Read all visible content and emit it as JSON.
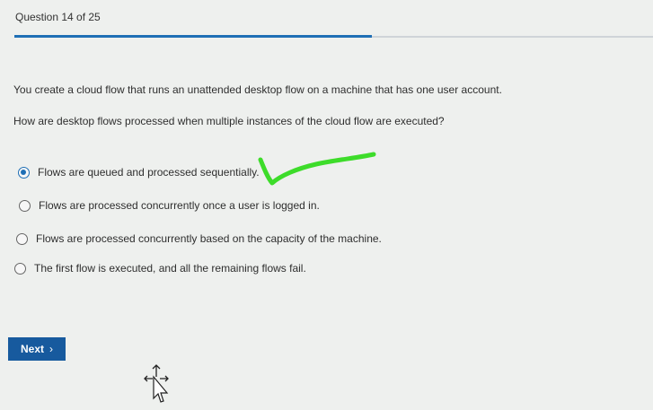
{
  "header": {
    "title": "Question 14 of 25",
    "progress": 0.56
  },
  "question": {
    "scenario": "You create a cloud flow that runs an unattended desktop flow on a machine that has one user account.",
    "prompt": "How are desktop flows processed when multiple instances of the cloud flow are executed?"
  },
  "options": [
    {
      "label": "Flows are queued and processed sequentially.",
      "selected": true
    },
    {
      "label": "Flows are processed concurrently once a user is logged in.",
      "selected": false
    },
    {
      "label": "Flows are processed concurrently based on the capacity of the machine.",
      "selected": false
    },
    {
      "label": "The first flow is executed, and all the remaining flows fail.",
      "selected": false
    }
  ],
  "footer": {
    "next_label": "Next",
    "next_icon": "chevron-right-icon"
  },
  "colors": {
    "accent": "#1f6fb5",
    "button": "#175a9e",
    "annotation": "#3ddc2a"
  }
}
